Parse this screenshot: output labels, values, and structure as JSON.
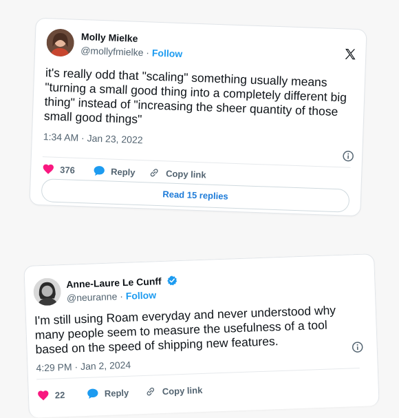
{
  "tweet1": {
    "author_name": "Molly Mielke",
    "handle": "@mollyfmielke",
    "separator": "·",
    "follow_label": "Follow",
    "text_lines": [
      "it's really odd that \"scaling\" something usually means",
      "\"turning a small good thing into a completely different big",
      "thing\" instead of \"increasing the sheer quantity of those",
      "small good things\""
    ],
    "timestamp": "1:34 AM · Jan 23, 2022",
    "likes": "376",
    "reply_label": "Reply",
    "copy_link_label": "Copy link",
    "read_replies_label": "Read 15 replies",
    "platform_icon": "x-logo-icon"
  },
  "tweet2": {
    "author_name": "Anne-Laure Le Cunff",
    "handle": "@neuranne",
    "separator": "·",
    "follow_label": "Follow",
    "verified": true,
    "text_lines": [
      "I'm still using Roam everyday and never understood why",
      "many people seem to measure the usefulness of a tool",
      "based on the speed of shipping new features."
    ],
    "timestamp": "4:29 PM · Jan 2, 2024",
    "likes": "22",
    "reply_label": "Reply",
    "copy_link_label": "Copy link"
  },
  "colors": {
    "like": "#f91880",
    "reply": "#1d9bf0",
    "follow": "#1d9bf0",
    "verified": "#1d9bf0"
  }
}
